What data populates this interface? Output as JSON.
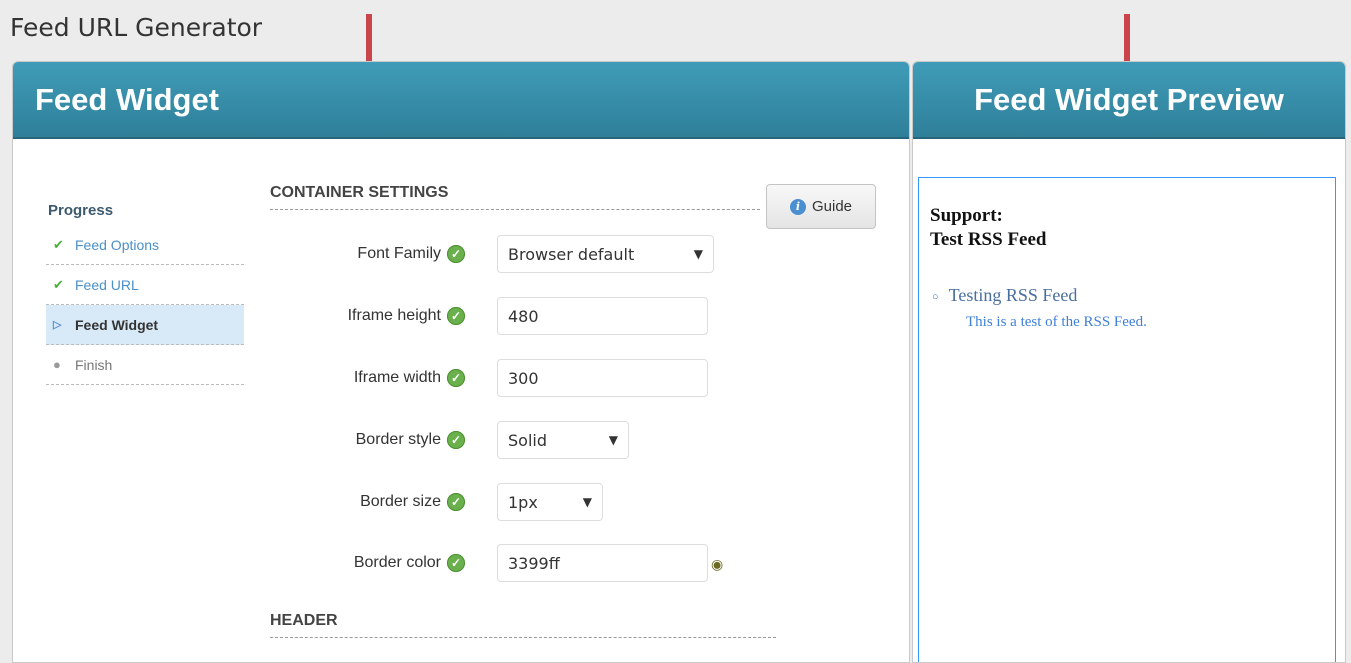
{
  "page_title": "Feed URL Generator",
  "left_panel": {
    "title": "Feed Widget"
  },
  "right_panel": {
    "title": "Feed Widget Preview"
  },
  "progress": {
    "title": "Progress",
    "steps": [
      {
        "label": "Feed Options",
        "state": "done",
        "icon": "check-icon"
      },
      {
        "label": "Feed URL",
        "state": "done",
        "icon": "check-icon"
      },
      {
        "label": "Feed Widget",
        "state": "active",
        "icon": "play-icon"
      },
      {
        "label": "Finish",
        "state": "pending",
        "icon": "circle-icon"
      }
    ]
  },
  "container_settings": {
    "heading": "CONTAINER SETTINGS",
    "guide_label": "Guide",
    "fields": {
      "font_family": {
        "label": "Font Family",
        "value": "Browser default"
      },
      "iframe_height": {
        "label": "Iframe height",
        "value": "480"
      },
      "iframe_width": {
        "label": "Iframe width",
        "value": "300"
      },
      "border_style": {
        "label": "Border style",
        "value": "Solid"
      },
      "border_size": {
        "label": "Border size",
        "value": "1px"
      },
      "border_color": {
        "label": "Border color",
        "value": "3399ff"
      }
    }
  },
  "header_section": {
    "heading": "HEADER"
  },
  "preview": {
    "title_line1": "Support:",
    "title_line2": "Test RSS Feed",
    "item_title": "Testing RSS Feed",
    "item_description": "This is a test of the RSS Feed.",
    "border_color": "#3399ff"
  },
  "colors": {
    "header_bar": "#3488a5",
    "annotation_arrow": "#c9454b",
    "check": "#6ab04c",
    "link": "#4a90c8"
  }
}
